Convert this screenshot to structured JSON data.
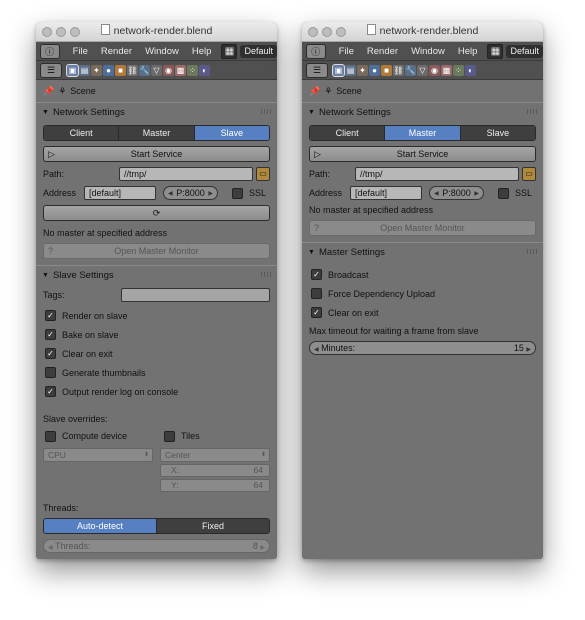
{
  "left": {
    "title": "network-render.blend",
    "menu": [
      "File",
      "Render",
      "Window",
      "Help"
    ],
    "layout": "Default",
    "scene": "Scene",
    "network_settings": "Network Settings",
    "modes": [
      "Client",
      "Master",
      "Slave"
    ],
    "active_mode": "Slave",
    "start_service": "Start Service",
    "path_label": "Path:",
    "path_value": "//tmp/",
    "address_label": "Address",
    "address_value": "[default]",
    "port_value": "P:8000",
    "ssl_label": "SSL",
    "status": "No master at specified address",
    "open_master_monitor": "Open Master Monitor",
    "slave_settings": "Slave Settings",
    "tags_label": "Tags:",
    "checkboxes": [
      {
        "label": "Render on slave",
        "checked": true
      },
      {
        "label": "Bake on slave",
        "checked": true
      },
      {
        "label": "Clear on exit",
        "checked": true
      },
      {
        "label": "Generate thumbnails",
        "checked": false
      },
      {
        "label": "Output render log on console",
        "checked": true
      }
    ],
    "slave_overrides": "Slave overrides:",
    "compute_device": "Compute device",
    "tiles": "Tiles",
    "cpu": "CPU",
    "center": "Center",
    "x_label": "X:",
    "x_value": "64",
    "y_label": "Y:",
    "y_value": "64",
    "threads_label": "Threads:",
    "thread_modes": [
      "Auto-detect",
      "Fixed"
    ],
    "active_thread_mode": "Auto-detect",
    "threads_field_label": "Threads:",
    "threads_value": "8"
  },
  "right": {
    "title": "network-render.blend",
    "menu": [
      "File",
      "Render",
      "Window",
      "Help"
    ],
    "layout": "Default",
    "scene": "Scene",
    "network_settings": "Network Settings",
    "modes": [
      "Client",
      "Master",
      "Slave"
    ],
    "active_mode": "Master",
    "start_service": "Start Service",
    "path_label": "Path:",
    "path_value": "//tmp/",
    "address_label": "Address",
    "address_value": "[default]",
    "port_value": "P:8000",
    "ssl_label": "SSL",
    "status": "No master at specified address",
    "open_master_monitor": "Open Master Monitor",
    "master_settings": "Master Settings",
    "checkboxes": [
      {
        "label": "Broadcast",
        "checked": true
      },
      {
        "label": "Force Dependency Upload",
        "checked": false
      },
      {
        "label": "Clear on exit",
        "checked": true
      }
    ],
    "timeout_label": "Max timeout for waiting a frame from slave",
    "minutes_label": "Minutes:",
    "minutes_value": "15"
  },
  "colors": {
    "panel": "#727272",
    "header": "#505050",
    "active": "#5680c2",
    "dark_button": "#3f3f3f"
  }
}
